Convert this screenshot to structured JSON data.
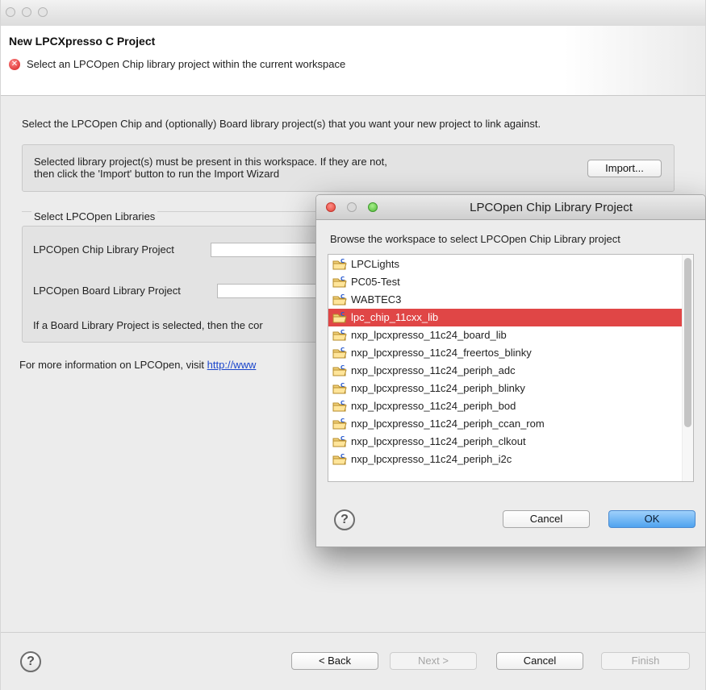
{
  "wizard": {
    "title": "New LPCXpresso C Project",
    "error_message": "Select an LPCOpen Chip library project within the current workspace",
    "intro": "Select the LPCOpen Chip and (optionally) Board library project(s) that you want your new project to link against.",
    "import_text_line1": "Selected library project(s) must be present in this workspace. If they are not,",
    "import_text_line2": "then click the 'Import' button to run the Import Wizard",
    "import_button": "Import...",
    "libs_legend": "Select LPCOpen Libraries",
    "chip_label": "LPCOpen Chip Library Project",
    "chip_value": "",
    "board_label": "LPCOpen Board Library Project",
    "board_value": "",
    "board_note": "If a Board Library Project is selected, then the cor",
    "more_info_prefix": "For more information on LPCOpen, visit ",
    "more_info_link": "http://www",
    "help_glyph": "?",
    "buttons": {
      "back": "< Back",
      "next": "Next >",
      "cancel": "Cancel",
      "finish": "Finish"
    }
  },
  "dialog": {
    "title": "LPCOpen Chip Library Project",
    "prompt": "Browse the workspace to select LPCOpen Chip Library project",
    "projects": [
      "LPCLights",
      "PC05-Test",
      "WABTEC3",
      "lpc_chip_11cxx_lib",
      "nxp_lpcxpresso_11c24_board_lib",
      "nxp_lpcxpresso_11c24_freertos_blinky",
      "nxp_lpcxpresso_11c24_periph_adc",
      "nxp_lpcxpresso_11c24_periph_blinky",
      "nxp_lpcxpresso_11c24_periph_bod",
      "nxp_lpcxpresso_11c24_periph_ccan_rom",
      "nxp_lpcxpresso_11c24_periph_clkout",
      "nxp_lpcxpresso_11c24_periph_i2c"
    ],
    "selected_index": 3,
    "help_glyph": "?",
    "buttons": {
      "cancel": "Cancel",
      "ok": "OK"
    }
  },
  "colors": {
    "selection": "#e04646",
    "link": "#1a45cc",
    "primary_button": "#4fa3ef"
  },
  "icons": {
    "project": "folder-project-icon",
    "error": "error-icon",
    "help": "help-icon"
  }
}
